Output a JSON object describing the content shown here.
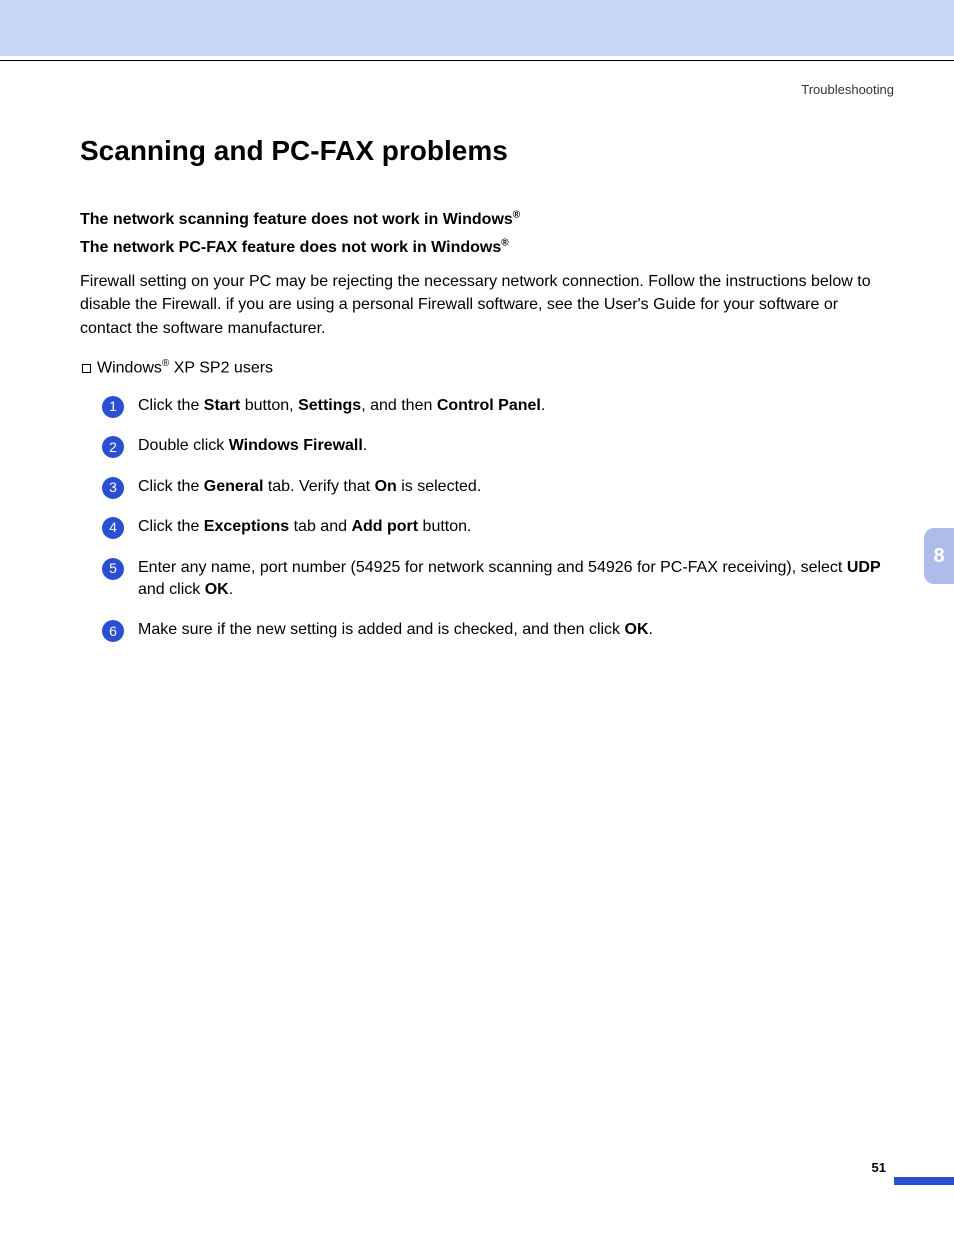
{
  "breadcrumb": "Troubleshooting",
  "section_title": "Scanning and PC-FAX problems",
  "subheading_1_pre": "The network scanning feature does not work in Windows",
  "subheading_1_sup": "®",
  "subheading_2_pre": "The network PC-FAX feature does not work in Windows",
  "subheading_2_sup": "®",
  "paragraph": "Firewall setting on your PC may be rejecting the necessary network connection. Follow the instructions below to disable the Firewall. if you are using a personal Firewall software, see the User's Guide for your software or contact the software manufacturer.",
  "bullet_pre": "Windows",
  "bullet_sup": "®",
  "bullet_post": " XP SP2 users",
  "steps": [
    {
      "n": "1",
      "pre": "Click the ",
      "b1": "Start",
      "mid1": " button, ",
      "b2": "Settings",
      "mid2": ", and then ",
      "b3": "Control Panel",
      "post": "."
    },
    {
      "n": "2",
      "pre": "Double click ",
      "b1": "Windows Firewall",
      "mid1": "",
      "b2": "",
      "mid2": "",
      "b3": "",
      "post": "."
    },
    {
      "n": "3",
      "pre": "Click the ",
      "b1": "General",
      "mid1": " tab. Verify that ",
      "b2": "On",
      "mid2": " is selected.",
      "b3": "",
      "post": ""
    },
    {
      "n": "4",
      "pre": "Click the ",
      "b1": "Exceptions",
      "mid1": " tab and ",
      "b2": "Add port",
      "mid2": " button.",
      "b3": "",
      "post": ""
    },
    {
      "n": "5",
      "pre": "Enter any name, port number (54925 for network scanning and 54926 for PC-FAX receiving), select ",
      "b1": "UDP",
      "mid1": " and click ",
      "b2": "OK",
      "mid2": ".",
      "b3": "",
      "post": ""
    },
    {
      "n": "6",
      "pre": "Make sure if the new setting is added and is checked, and then click ",
      "b1": "OK",
      "mid1": ".",
      "b2": "",
      "mid2": "",
      "b3": "",
      "post": ""
    }
  ],
  "side_tab": "8",
  "page_number": "51"
}
